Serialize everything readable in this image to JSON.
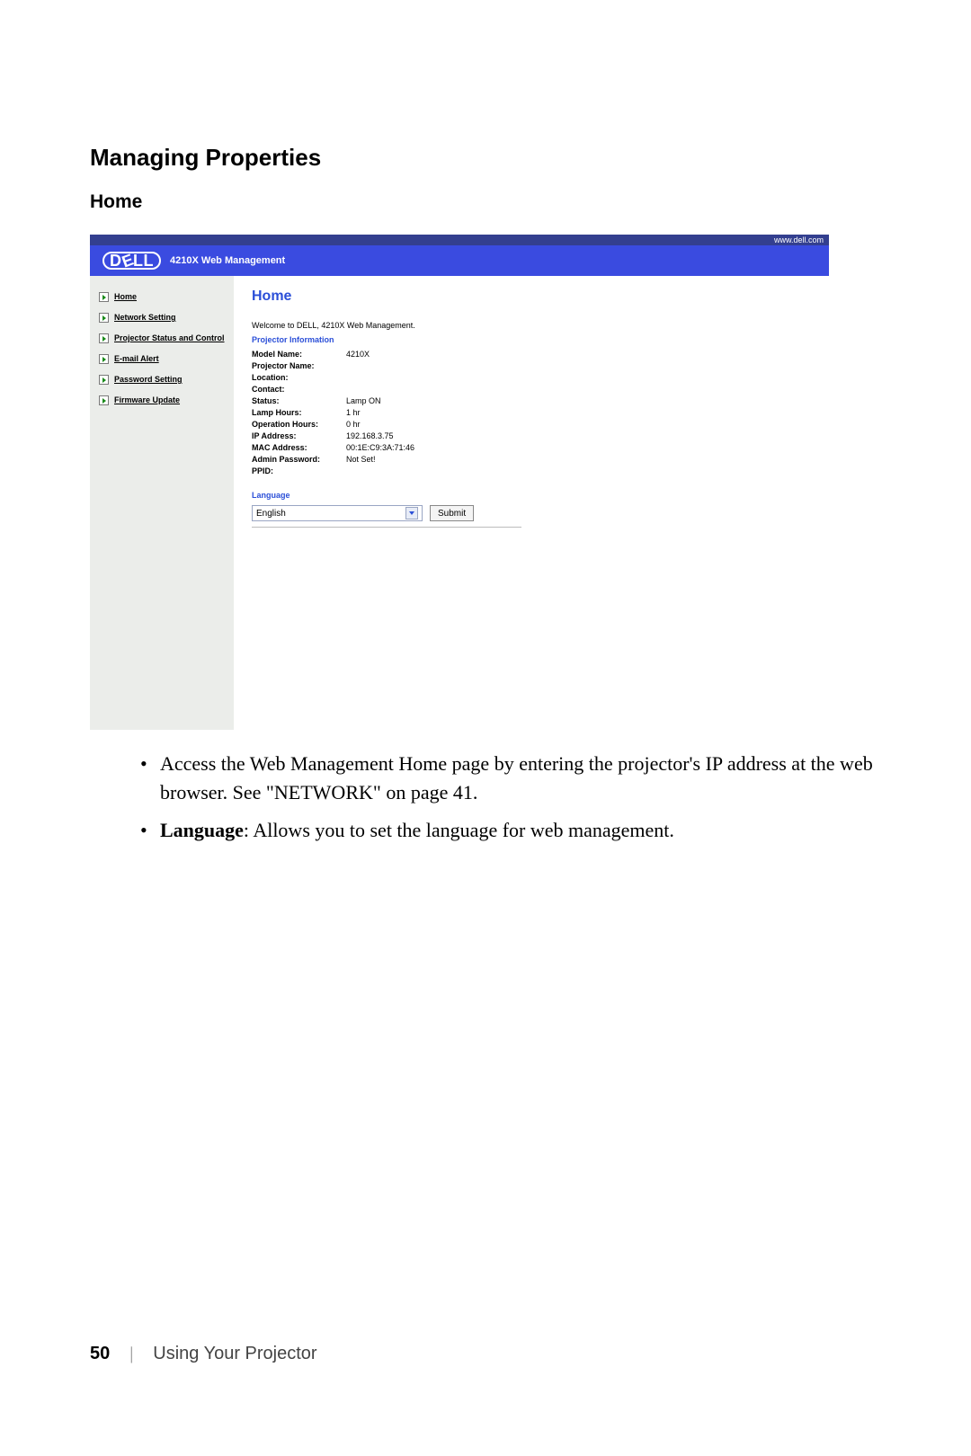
{
  "headings": {
    "h1": "Managing Properties",
    "h2": "Home"
  },
  "screenshot": {
    "url_bar": "www.dell.com",
    "header_title": "4210X Web Management",
    "nav": [
      "Home",
      "Network Setting",
      "Projector Status and Control",
      "E-mail Alert",
      "Password Setting",
      "Firmware Update"
    ],
    "content_title": "Home",
    "welcome": "Welcome to DELL, 4210X Web Management.",
    "section_projector_info": "Projector Information",
    "info": {
      "model_name": {
        "label": "Model Name:",
        "value": "4210X"
      },
      "projector_name": {
        "label": "Projector Name:",
        "value": ""
      },
      "location": {
        "label": "Location:",
        "value": ""
      },
      "contact": {
        "label": "Contact:",
        "value": ""
      },
      "status": {
        "label": "Status:",
        "value": "Lamp ON"
      },
      "lamp_hours": {
        "label": "Lamp Hours:",
        "value": "1 hr"
      },
      "operation_hours": {
        "label": "Operation Hours:",
        "value": "0 hr"
      },
      "ip_address": {
        "label": "IP Address:",
        "value": "192.168.3.75"
      },
      "mac_address": {
        "label": "MAC Address:",
        "value": "00:1E:C9:3A:71:46"
      },
      "admin_password": {
        "label": "Admin Password:",
        "value": "Not Set!"
      },
      "ppid": {
        "label": "PPID:",
        "value": ""
      }
    },
    "section_language": "Language",
    "language_value": "English",
    "submit_label": "Submit"
  },
  "bullets": {
    "b1": "Access the Web Management Home page by entering the projector's IP address at the web browser. See \"NETWORK\" on page 41.",
    "b2_strong": "Language",
    "b2_rest": ": Allows you to set the language for web management."
  },
  "footer": {
    "page_num": "50",
    "title": "Using Your Projector"
  }
}
